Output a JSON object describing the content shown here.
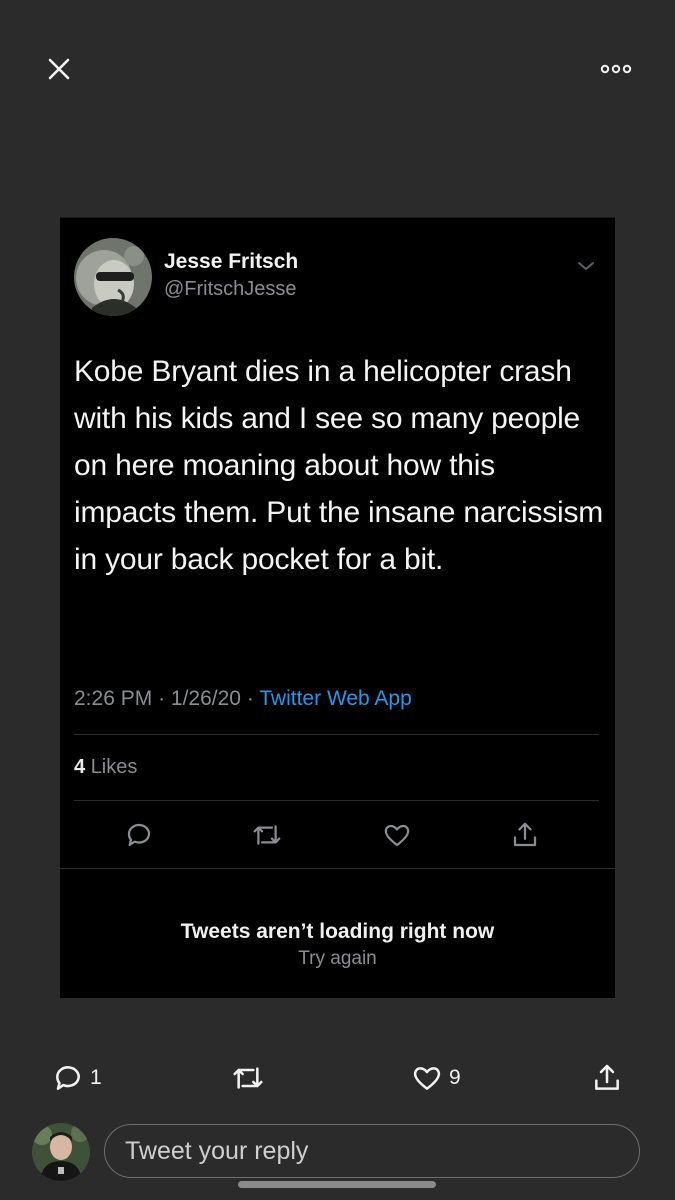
{
  "viewer": {
    "close_icon": "close-icon",
    "more_icon": "more-options-icon"
  },
  "tweet": {
    "author_name": "Jesse Fritsch",
    "author_handle": "@FritschJesse",
    "text": "Kobe Bryant dies in a helicopter crash with his kids and I see so many people on here moaning about how this impacts them. Put the insane narcissism in your back pocket for a bit.",
    "time": "2:26 PM",
    "date": "1/26/20",
    "source": "Twitter Web App",
    "likes_count": "4",
    "likes_label": "Likes",
    "error_title": "Tweets aren’t loading right now",
    "error_retry": "Try again",
    "source_color": "#1d9bf0"
  },
  "actions": {
    "reply_count": "1",
    "like_count": "9"
  },
  "composer": {
    "placeholder": "Tweet your reply"
  }
}
